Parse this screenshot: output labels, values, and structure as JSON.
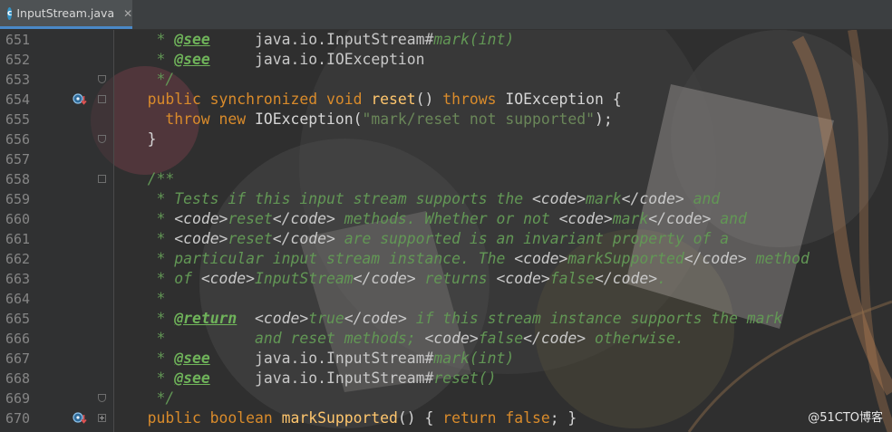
{
  "tab": {
    "filename": "InputStream.java",
    "icon_letter": "c",
    "close_glyph": "✕"
  },
  "editor": {
    "lines": [
      {
        "num": "651",
        "parts": [
          [
            "doc",
            "    * "
          ],
          [
            "tag",
            "@see"
          ],
          [
            "doc",
            "     "
          ],
          [
            "ref",
            "java.io.InputStream#"
          ],
          [
            "doc",
            "mark(int)"
          ]
        ]
      },
      {
        "num": "652",
        "parts": [
          [
            "doc",
            "    * "
          ],
          [
            "tag",
            "@see"
          ],
          [
            "doc",
            "     "
          ],
          [
            "ref",
            "java.io.IOException"
          ]
        ]
      },
      {
        "num": "653",
        "parts": [
          [
            "doc",
            "    */"
          ]
        ]
      },
      {
        "num": "654",
        "parts": [
          [
            "kw",
            "   public synchronized void "
          ],
          [
            "fn",
            "reset"
          ],
          [
            "plain",
            "() "
          ],
          [
            "kw",
            "throws "
          ],
          [
            "plain",
            "IOException {"
          ]
        ]
      },
      {
        "num": "655",
        "parts": [
          [
            "kw",
            "     throw new "
          ],
          [
            "plain",
            "IOException("
          ],
          [
            "str",
            "\"mark/reset not supported\""
          ],
          [
            "plain",
            ");"
          ]
        ]
      },
      {
        "num": "656",
        "parts": [
          [
            "plain",
            "   }"
          ]
        ]
      },
      {
        "num": "657",
        "parts": []
      },
      {
        "num": "658",
        "parts": [
          [
            "doc",
            "   /**"
          ]
        ]
      },
      {
        "num": "659",
        "parts": [
          [
            "doc",
            "    * Tests if this input stream supports the "
          ],
          [
            "html",
            "<code>"
          ],
          [
            "doc",
            "mark"
          ],
          [
            "html",
            "</code>"
          ],
          [
            "doc",
            " and"
          ]
        ]
      },
      {
        "num": "660",
        "parts": [
          [
            "doc",
            "    * "
          ],
          [
            "html",
            "<code>"
          ],
          [
            "doc",
            "reset"
          ],
          [
            "html",
            "</code>"
          ],
          [
            "doc",
            " methods. Whether or not "
          ],
          [
            "html",
            "<code>"
          ],
          [
            "doc",
            "mark"
          ],
          [
            "html",
            "</code>"
          ],
          [
            "doc",
            " and"
          ]
        ]
      },
      {
        "num": "661",
        "parts": [
          [
            "doc",
            "    * "
          ],
          [
            "html",
            "<code>"
          ],
          [
            "doc",
            "reset"
          ],
          [
            "html",
            "</code>"
          ],
          [
            "doc",
            " are supported is an invariant property of a"
          ]
        ]
      },
      {
        "num": "662",
        "parts": [
          [
            "doc",
            "    * particular input stream instance. The "
          ],
          [
            "html",
            "<code>"
          ],
          [
            "doc",
            "markSupported"
          ],
          [
            "html",
            "</code>"
          ],
          [
            "doc",
            " method"
          ]
        ]
      },
      {
        "num": "663",
        "parts": [
          [
            "doc",
            "    * of "
          ],
          [
            "html",
            "<code>"
          ],
          [
            "doc",
            "InputStream"
          ],
          [
            "html",
            "</code>"
          ],
          [
            "doc",
            " returns "
          ],
          [
            "html",
            "<code>"
          ],
          [
            "doc",
            "false"
          ],
          [
            "html",
            "</code>"
          ],
          [
            "doc",
            "."
          ]
        ]
      },
      {
        "num": "664",
        "parts": [
          [
            "doc",
            "    *"
          ]
        ]
      },
      {
        "num": "665",
        "parts": [
          [
            "doc",
            "    * "
          ],
          [
            "tag",
            "@return"
          ],
          [
            "doc",
            "  "
          ],
          [
            "html",
            "<code>"
          ],
          [
            "doc",
            "true"
          ],
          [
            "html",
            "</code>"
          ],
          [
            "doc",
            " if this stream instance supports the mark"
          ]
        ]
      },
      {
        "num": "666",
        "parts": [
          [
            "doc",
            "    *          and reset methods; "
          ],
          [
            "html",
            "<code>"
          ],
          [
            "doc",
            "false"
          ],
          [
            "html",
            "</code>"
          ],
          [
            "doc",
            " otherwise."
          ]
        ]
      },
      {
        "num": "667",
        "parts": [
          [
            "doc",
            "    * "
          ],
          [
            "tag",
            "@see"
          ],
          [
            "doc",
            "     "
          ],
          [
            "ref",
            "java.io.InputStream#"
          ],
          [
            "doc",
            "mark(int)"
          ]
        ]
      },
      {
        "num": "668",
        "parts": [
          [
            "doc",
            "    * "
          ],
          [
            "tag",
            "@see"
          ],
          [
            "doc",
            "     "
          ],
          [
            "ref",
            "java.io.InputStream#"
          ],
          [
            "doc",
            "reset()"
          ]
        ]
      },
      {
        "num": "669",
        "parts": [
          [
            "doc",
            "    */"
          ]
        ]
      },
      {
        "num": "670",
        "parts": [
          [
            "kw",
            "   public boolean "
          ],
          [
            "fn",
            "markSupported"
          ],
          [
            "plain",
            "() { "
          ],
          [
            "kw",
            "return false"
          ],
          [
            "plain",
            "; }"
          ]
        ]
      }
    ]
  },
  "watermark": "@51CTO博客",
  "colors": {
    "keyword": "#d98b2b",
    "doc": "#629755",
    "string": "#6a8759",
    "method": "#ffc66d"
  }
}
